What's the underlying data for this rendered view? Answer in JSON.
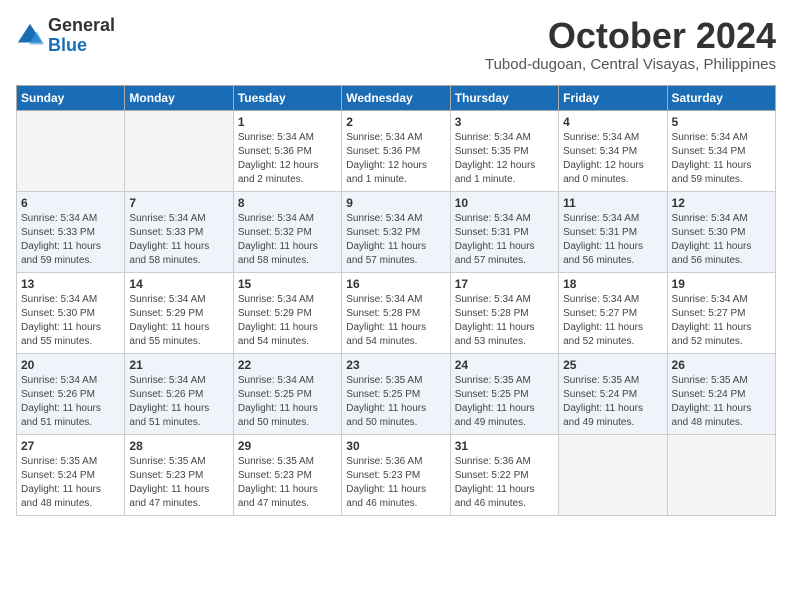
{
  "header": {
    "logo": {
      "general": "General",
      "blue": "Blue"
    },
    "title": "October 2024",
    "location": "Tubod-dugoan, Central Visayas, Philippines"
  },
  "days_header": [
    "Sunday",
    "Monday",
    "Tuesday",
    "Wednesday",
    "Thursday",
    "Friday",
    "Saturday"
  ],
  "weeks": [
    [
      {
        "day": "",
        "info": ""
      },
      {
        "day": "",
        "info": ""
      },
      {
        "day": "1",
        "info": "Sunrise: 5:34 AM\nSunset: 5:36 PM\nDaylight: 12 hours\nand 2 minutes."
      },
      {
        "day": "2",
        "info": "Sunrise: 5:34 AM\nSunset: 5:36 PM\nDaylight: 12 hours\nand 1 minute."
      },
      {
        "day": "3",
        "info": "Sunrise: 5:34 AM\nSunset: 5:35 PM\nDaylight: 12 hours\nand 1 minute."
      },
      {
        "day": "4",
        "info": "Sunrise: 5:34 AM\nSunset: 5:34 PM\nDaylight: 12 hours\nand 0 minutes."
      },
      {
        "day": "5",
        "info": "Sunrise: 5:34 AM\nSunset: 5:34 PM\nDaylight: 11 hours\nand 59 minutes."
      }
    ],
    [
      {
        "day": "6",
        "info": "Sunrise: 5:34 AM\nSunset: 5:33 PM\nDaylight: 11 hours\nand 59 minutes."
      },
      {
        "day": "7",
        "info": "Sunrise: 5:34 AM\nSunset: 5:33 PM\nDaylight: 11 hours\nand 58 minutes."
      },
      {
        "day": "8",
        "info": "Sunrise: 5:34 AM\nSunset: 5:32 PM\nDaylight: 11 hours\nand 58 minutes."
      },
      {
        "day": "9",
        "info": "Sunrise: 5:34 AM\nSunset: 5:32 PM\nDaylight: 11 hours\nand 57 minutes."
      },
      {
        "day": "10",
        "info": "Sunrise: 5:34 AM\nSunset: 5:31 PM\nDaylight: 11 hours\nand 57 minutes."
      },
      {
        "day": "11",
        "info": "Sunrise: 5:34 AM\nSunset: 5:31 PM\nDaylight: 11 hours\nand 56 minutes."
      },
      {
        "day": "12",
        "info": "Sunrise: 5:34 AM\nSunset: 5:30 PM\nDaylight: 11 hours\nand 56 minutes."
      }
    ],
    [
      {
        "day": "13",
        "info": "Sunrise: 5:34 AM\nSunset: 5:30 PM\nDaylight: 11 hours\nand 55 minutes."
      },
      {
        "day": "14",
        "info": "Sunrise: 5:34 AM\nSunset: 5:29 PM\nDaylight: 11 hours\nand 55 minutes."
      },
      {
        "day": "15",
        "info": "Sunrise: 5:34 AM\nSunset: 5:29 PM\nDaylight: 11 hours\nand 54 minutes."
      },
      {
        "day": "16",
        "info": "Sunrise: 5:34 AM\nSunset: 5:28 PM\nDaylight: 11 hours\nand 54 minutes."
      },
      {
        "day": "17",
        "info": "Sunrise: 5:34 AM\nSunset: 5:28 PM\nDaylight: 11 hours\nand 53 minutes."
      },
      {
        "day": "18",
        "info": "Sunrise: 5:34 AM\nSunset: 5:27 PM\nDaylight: 11 hours\nand 52 minutes."
      },
      {
        "day": "19",
        "info": "Sunrise: 5:34 AM\nSunset: 5:27 PM\nDaylight: 11 hours\nand 52 minutes."
      }
    ],
    [
      {
        "day": "20",
        "info": "Sunrise: 5:34 AM\nSunset: 5:26 PM\nDaylight: 11 hours\nand 51 minutes."
      },
      {
        "day": "21",
        "info": "Sunrise: 5:34 AM\nSunset: 5:26 PM\nDaylight: 11 hours\nand 51 minutes."
      },
      {
        "day": "22",
        "info": "Sunrise: 5:34 AM\nSunset: 5:25 PM\nDaylight: 11 hours\nand 50 minutes."
      },
      {
        "day": "23",
        "info": "Sunrise: 5:35 AM\nSunset: 5:25 PM\nDaylight: 11 hours\nand 50 minutes."
      },
      {
        "day": "24",
        "info": "Sunrise: 5:35 AM\nSunset: 5:25 PM\nDaylight: 11 hours\nand 49 minutes."
      },
      {
        "day": "25",
        "info": "Sunrise: 5:35 AM\nSunset: 5:24 PM\nDaylight: 11 hours\nand 49 minutes."
      },
      {
        "day": "26",
        "info": "Sunrise: 5:35 AM\nSunset: 5:24 PM\nDaylight: 11 hours\nand 48 minutes."
      }
    ],
    [
      {
        "day": "27",
        "info": "Sunrise: 5:35 AM\nSunset: 5:24 PM\nDaylight: 11 hours\nand 48 minutes."
      },
      {
        "day": "28",
        "info": "Sunrise: 5:35 AM\nSunset: 5:23 PM\nDaylight: 11 hours\nand 47 minutes."
      },
      {
        "day": "29",
        "info": "Sunrise: 5:35 AM\nSunset: 5:23 PM\nDaylight: 11 hours\nand 47 minutes."
      },
      {
        "day": "30",
        "info": "Sunrise: 5:36 AM\nSunset: 5:23 PM\nDaylight: 11 hours\nand 46 minutes."
      },
      {
        "day": "31",
        "info": "Sunrise: 5:36 AM\nSunset: 5:22 PM\nDaylight: 11 hours\nand 46 minutes."
      },
      {
        "day": "",
        "info": ""
      },
      {
        "day": "",
        "info": ""
      }
    ]
  ]
}
